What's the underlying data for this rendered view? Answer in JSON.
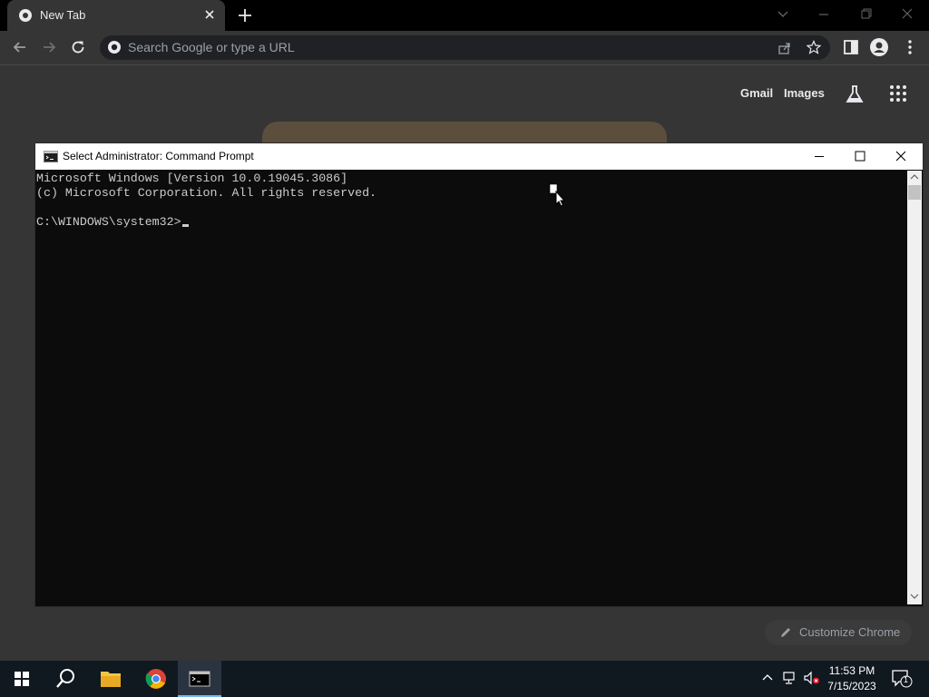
{
  "browser": {
    "tab_title": "New Tab",
    "omnibox_placeholder": "Search Google or type a URL",
    "ntp": {
      "gmail_label": "Gmail",
      "images_label": "Images",
      "customize_label": "Customize Chrome"
    }
  },
  "cmd": {
    "window_title": "Select Administrator: Command Prompt",
    "lines": [
      "Microsoft Windows [Version 10.0.19045.3086]",
      "(c) Microsoft Corporation. All rights reserved.",
      "",
      "C:\\WINDOWS\\system32>"
    ]
  },
  "taskbar": {
    "clock_time": "11:53 PM",
    "clock_date": "7/15/2023",
    "notification_count": "1"
  },
  "colors": {
    "browser_bg": "#353535",
    "cmd_bg": "#0c0c0c",
    "cmd_text": "#cccccc",
    "taskbar_bg": "#101820",
    "accent": "#76b9ed"
  }
}
